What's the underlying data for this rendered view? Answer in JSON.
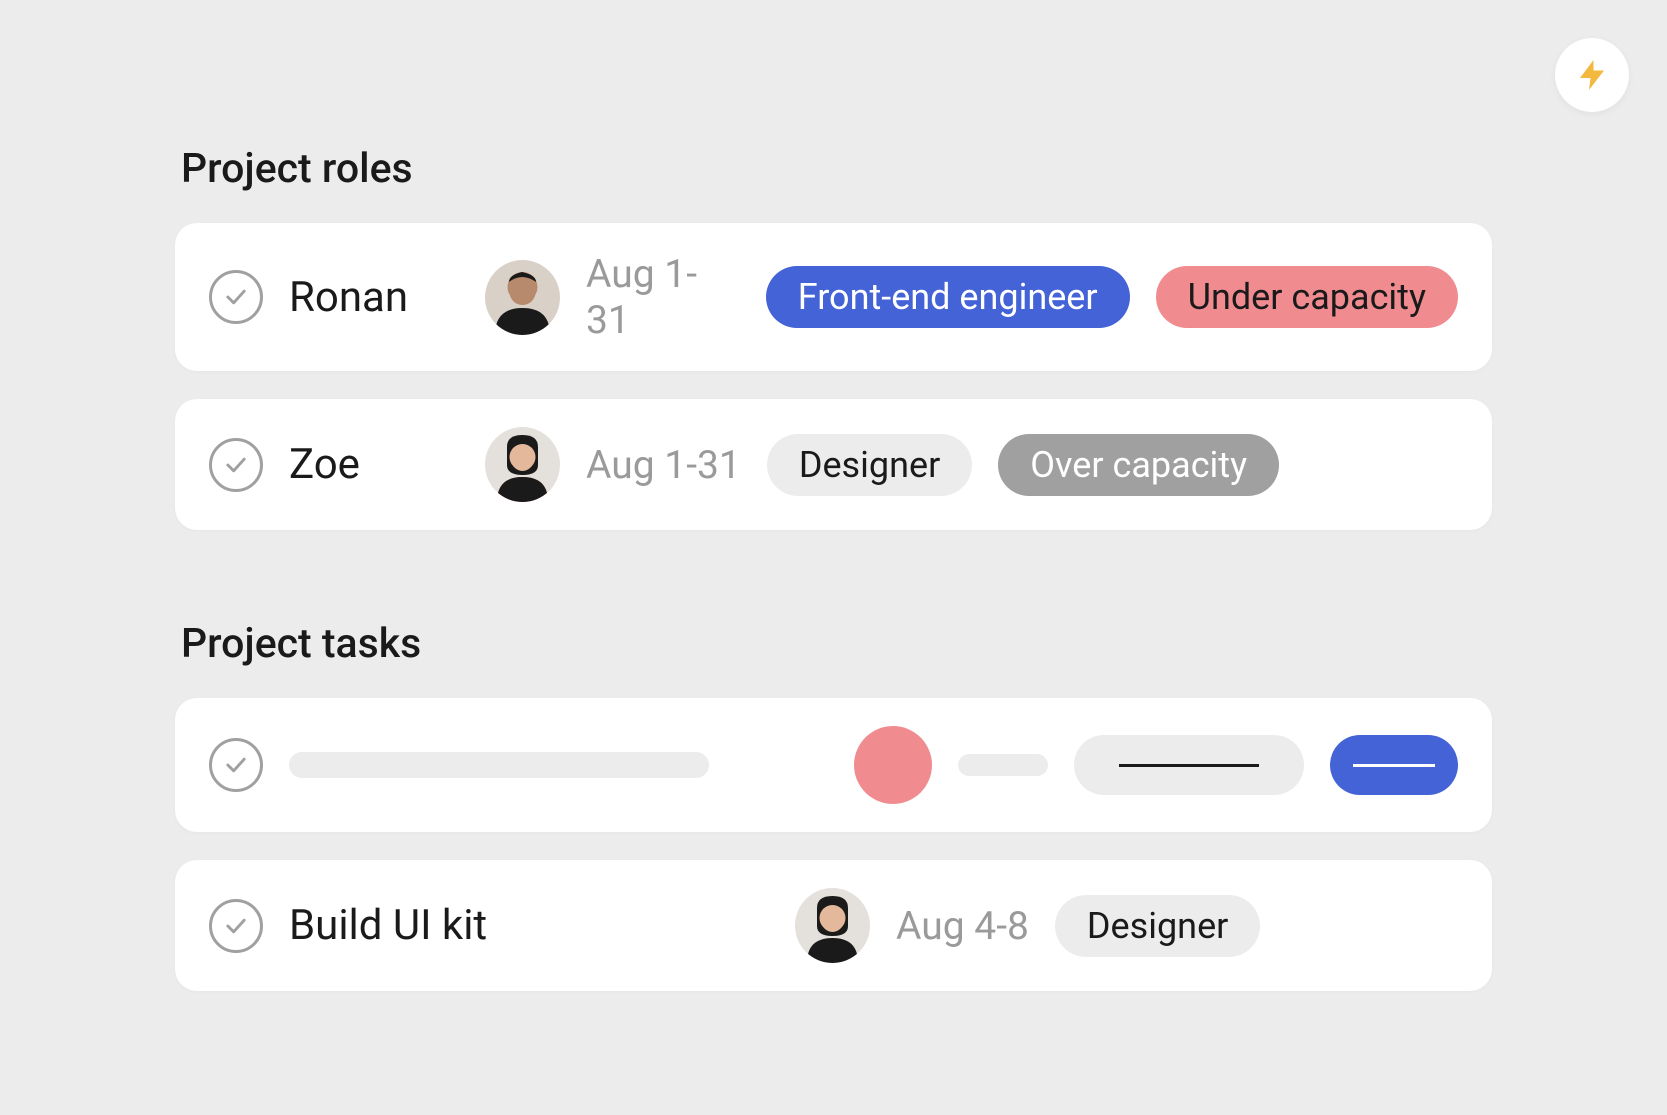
{
  "lightning_icon": "bolt-icon",
  "sections": {
    "roles": {
      "title": "Project roles",
      "items": [
        {
          "name": "Ronan",
          "avatar_bg": "#d9d0c8",
          "avatar_skin": "#b88a6d",
          "avatar_shirt": "#1a1a1a",
          "date": "Aug 1-31",
          "tag1": {
            "label": "Front-end engineer",
            "style": "blue"
          },
          "tag2": {
            "label": "Under capacity",
            "style": "pink"
          }
        },
        {
          "name": "Zoe",
          "avatar_bg": "#e4e0dc",
          "avatar_skin": "#e4b89a",
          "avatar_shirt": "#c83a3a",
          "date": "Aug 1-31",
          "tag1": {
            "label": "Designer",
            "style": "light"
          },
          "tag2": {
            "label": "Over capacity",
            "style": "gray"
          }
        }
      ]
    },
    "tasks": {
      "title": "Project tasks",
      "items": [
        {
          "name": "Build UI kit",
          "avatar_bg": "#e4e0dc",
          "avatar_skin": "#e4b89a",
          "avatar_shirt": "#c83a3a",
          "date": "Aug 4-8",
          "tag": {
            "label": "Designer",
            "style": "light"
          }
        }
      ]
    }
  }
}
